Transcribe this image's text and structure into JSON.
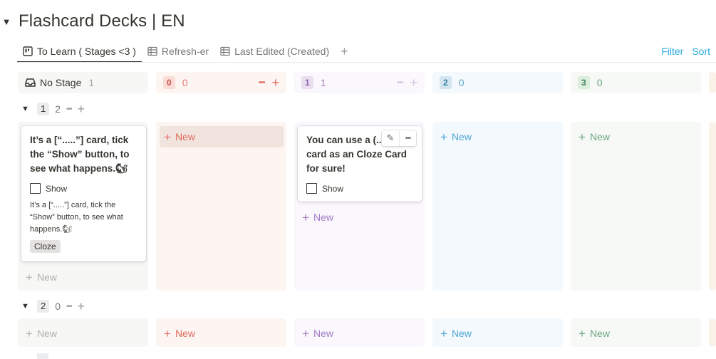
{
  "page": {
    "title": "Flashcard Decks | EN"
  },
  "tabs": [
    {
      "label": "To Learn ( Stages <3 )",
      "icon": "board-icon",
      "active": true
    },
    {
      "label": "Refresh-er",
      "icon": "table-icon",
      "active": false
    },
    {
      "label": "Last Edited (Created)",
      "icon": "table-icon",
      "active": false
    }
  ],
  "tab_add": "+",
  "toolbar": {
    "filter": "Filter",
    "sort": "Sort"
  },
  "columns": [
    {
      "label": "No Stage",
      "count": "1",
      "icon": "inbox-icon",
      "bg": "#f7f7f5",
      "pill_bg": "",
      "pill_color": ""
    },
    {
      "label": "0",
      "count": "0",
      "bg": "#fdf5f2",
      "pill_bg": "#fbdbd6",
      "pill_color": "#c4554d"
    },
    {
      "label": "1",
      "count": "1",
      "bg": "#faf7fd",
      "pill_bg": "#e8deee",
      "pill_color": "#9065b0"
    },
    {
      "label": "2",
      "count": "0",
      "bg": "#f3f9fc",
      "pill_bg": "#d3e5ef",
      "pill_color": "#337ea9"
    },
    {
      "label": "3",
      "count": "0",
      "bg": "#f6f9f5",
      "pill_bg": "#dbeddb",
      "pill_color": "#448361"
    }
  ],
  "col_actions": {
    "more": "•••",
    "add": "+"
  },
  "groups": [
    {
      "label": "1",
      "count": "2",
      "more": "•••",
      "add": "+"
    },
    {
      "label": "2",
      "count": "0",
      "more": "•••",
      "add": "+"
    }
  ],
  "new_label": "New",
  "cards": {
    "card1": {
      "title": "It’s a [“.....”] card, tick the “Show” button, to see what happens.🐿",
      "checkbox_label": "Show",
      "text": "It’s a [“.....”] card, tick the “Show” button, to see what happens.🐿",
      "tag": "Cloze"
    },
    "card2": {
      "title": "You can use a (.....) card as an Cloze Card for sure!",
      "checkbox_label": "Show"
    }
  },
  "colors": {
    "accent": "#2eaadc",
    "text": "#37352f",
    "muted": "#787774",
    "red_new": "#e06b5e",
    "purple_new": "#a27bc5",
    "blue_new": "#4ea5d4",
    "green_new": "#6ea683",
    "gray_new": "#b3b2ae"
  }
}
